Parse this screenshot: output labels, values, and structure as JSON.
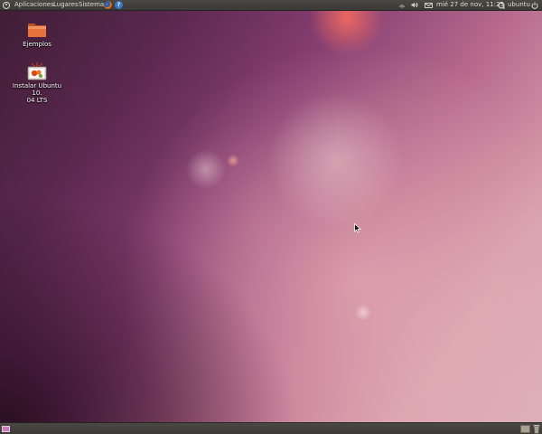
{
  "top_panel": {
    "menus": [
      "Aplicaciones",
      "Lugares",
      "Sistema"
    ],
    "clock": "mié 27 de nov, 11:25",
    "user": "ubuntu"
  },
  "desktop": {
    "icons": [
      {
        "label": "Ejemplos",
        "icon": "folder-icon"
      },
      {
        "label": "Instalar Ubuntu 10.\n04 LTS",
        "icon": "installer-icon"
      }
    ]
  },
  "colors": {
    "panel": "#3c3b37",
    "panel_text": "#dfdbd2",
    "wallpaper_dark": "#3e1d34",
    "wallpaper_light": "#ddb0b8",
    "folder_orange": "#e8703a"
  }
}
